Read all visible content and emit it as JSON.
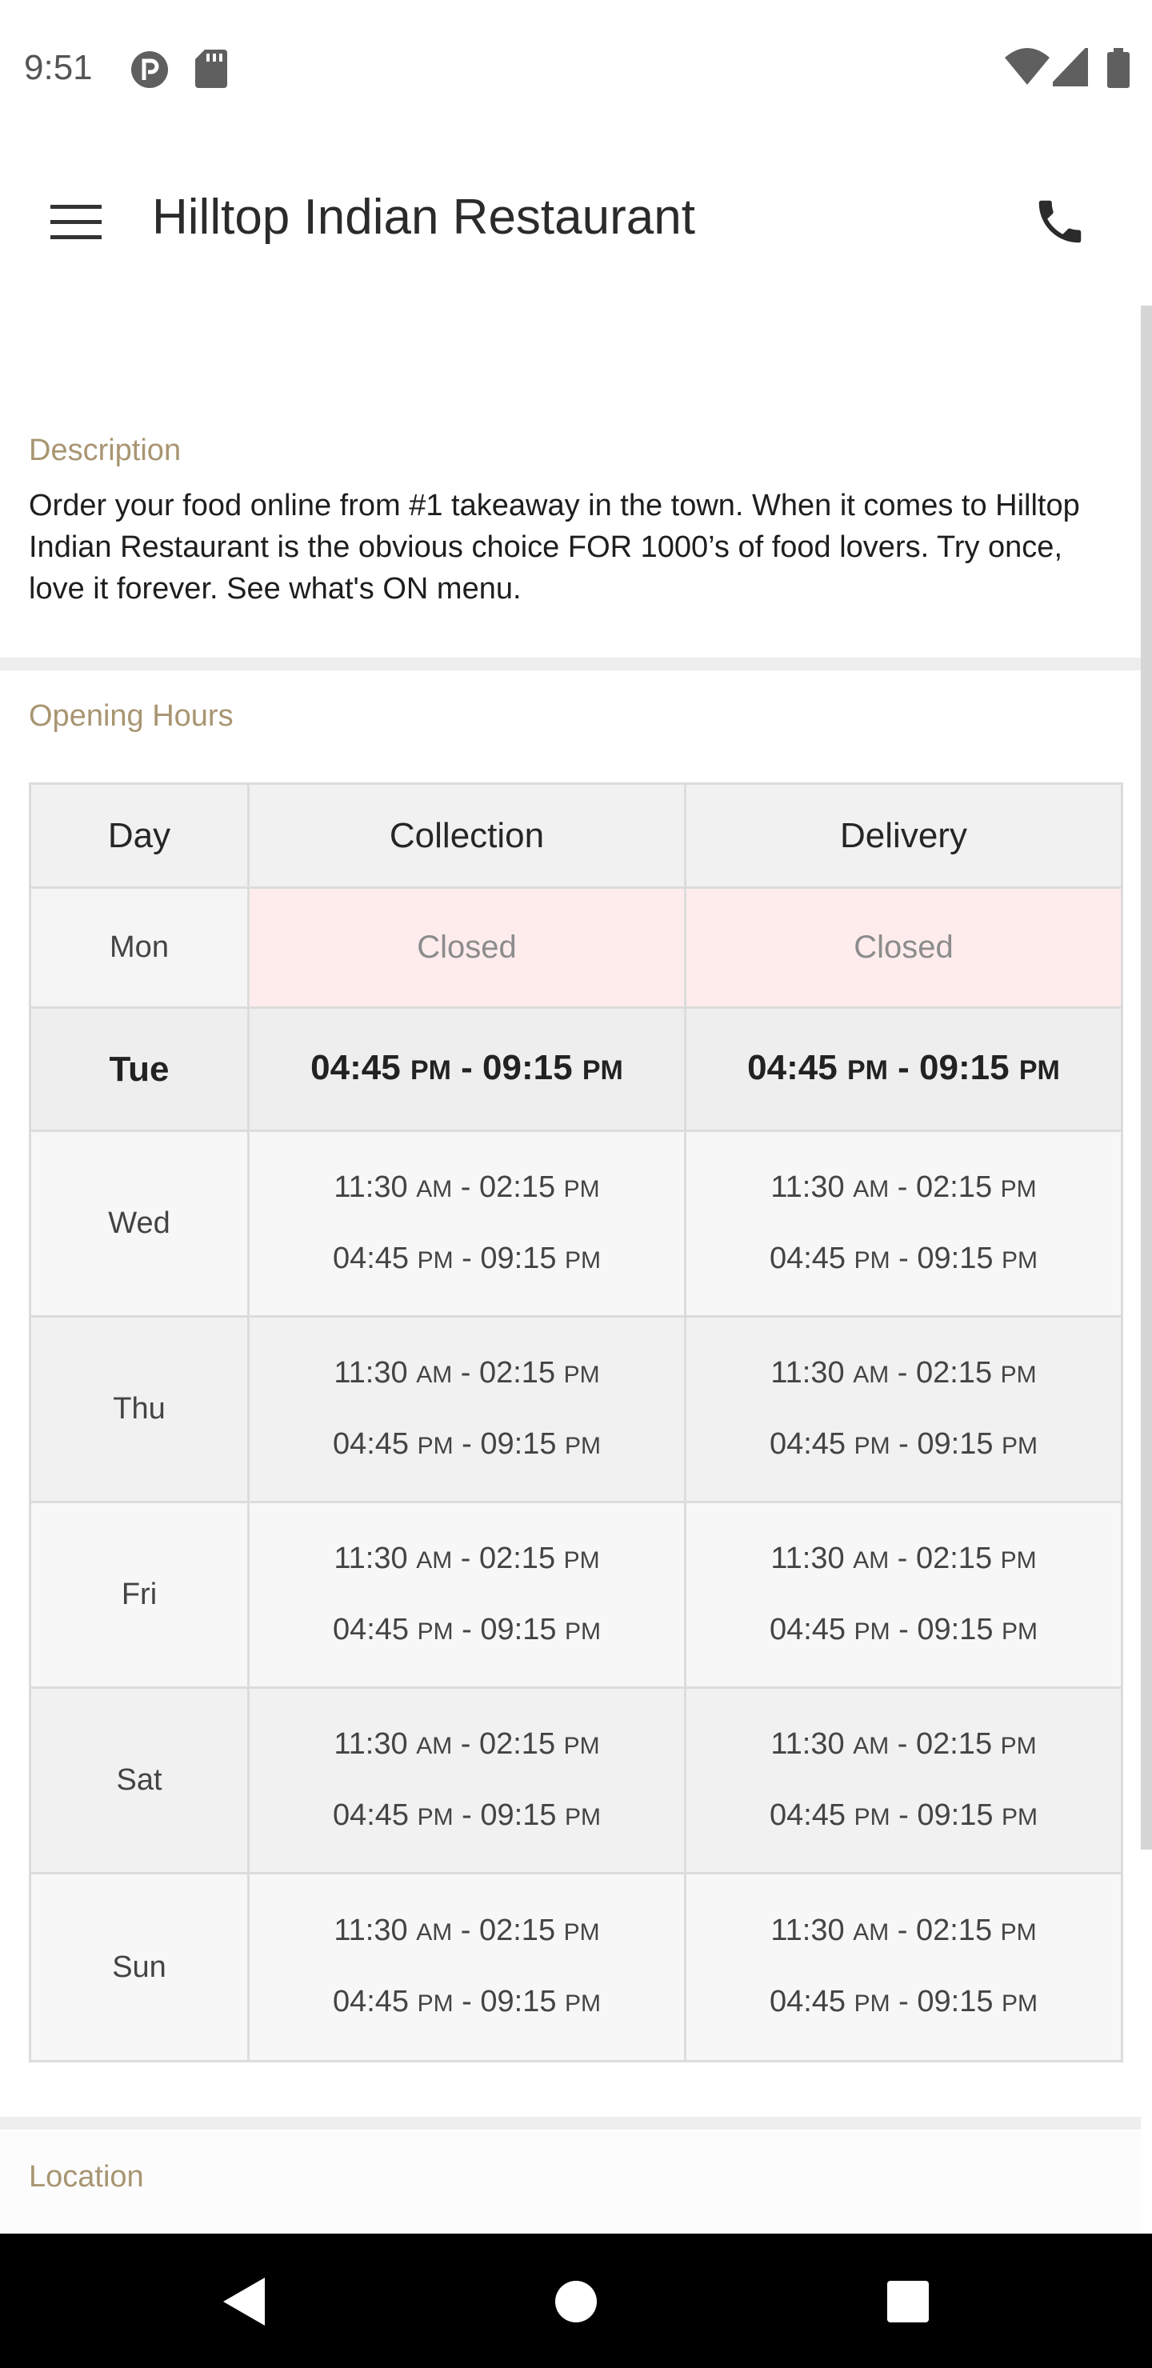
{
  "status_bar": {
    "time": "9:51",
    "left_icons": [
      "podcast-icon",
      "sd-card-icon"
    ],
    "right_icons": [
      "wifi-icon",
      "signal-icon",
      "battery-icon"
    ]
  },
  "app_bar": {
    "title": "Hilltop Indian Restaurant",
    "menu_icon": "hamburger-menu-icon",
    "call_icon": "phone-icon"
  },
  "description": {
    "label": "Description",
    "text": "Order your food online from #1 takeaway in the town. When it comes to Hilltop Indian Restaurant is the obvious choice FOR 1000’s of food lovers. Try once, love it forever. See what's ON menu."
  },
  "opening_hours": {
    "label": "Opening Hours",
    "headers": {
      "day": "Day",
      "collection": "Collection",
      "delivery": "Delivery"
    },
    "mon": {
      "day": "Mon",
      "collection": "Closed",
      "delivery": "Closed"
    },
    "tue": {
      "day": "Tue",
      "collection": {
        "start": "04:45",
        "start_ampm": "PM",
        "sep": " - ",
        "end": "09:15",
        "end_ampm": "PM"
      },
      "delivery": {
        "start": "04:45",
        "start_ampm": "PM",
        "sep": " - ",
        "end": "09:15",
        "end_ampm": "PM"
      }
    },
    "days": [
      {
        "day": "Wed",
        "collection": [
          {
            "start": "11:30",
            "start_ampm": "AM",
            "sep": " - ",
            "end": "02:15",
            "end_ampm": "PM"
          },
          {
            "start": "04:45",
            "start_ampm": "PM",
            "sep": " - ",
            "end": "09:15",
            "end_ampm": "PM"
          }
        ],
        "delivery": [
          {
            "start": "11:30",
            "start_ampm": "AM",
            "sep": " - ",
            "end": "02:15",
            "end_ampm": "PM"
          },
          {
            "start": "04:45",
            "start_ampm": "PM",
            "sep": " - ",
            "end": "09:15",
            "end_ampm": "PM"
          }
        ]
      },
      {
        "day": "Thu",
        "collection": [
          {
            "start": "11:30",
            "start_ampm": "AM",
            "sep": " - ",
            "end": "02:15",
            "end_ampm": "PM"
          },
          {
            "start": "04:45",
            "start_ampm": "PM",
            "sep": " - ",
            "end": "09:15",
            "end_ampm": "PM"
          }
        ],
        "delivery": [
          {
            "start": "11:30",
            "start_ampm": "AM",
            "sep": " - ",
            "end": "02:15",
            "end_ampm": "PM"
          },
          {
            "start": "04:45",
            "start_ampm": "PM",
            "sep": " - ",
            "end": "09:15",
            "end_ampm": "PM"
          }
        ]
      },
      {
        "day": "Fri",
        "collection": [
          {
            "start": "11:30",
            "start_ampm": "AM",
            "sep": " - ",
            "end": "02:15",
            "end_ampm": "PM"
          },
          {
            "start": "04:45",
            "start_ampm": "PM",
            "sep": " - ",
            "end": "09:15",
            "end_ampm": "PM"
          }
        ],
        "delivery": [
          {
            "start": "11:30",
            "start_ampm": "AM",
            "sep": " - ",
            "end": "02:15",
            "end_ampm": "PM"
          },
          {
            "start": "04:45",
            "start_ampm": "PM",
            "sep": " - ",
            "end": "09:15",
            "end_ampm": "PM"
          }
        ]
      },
      {
        "day": "Sat",
        "collection": [
          {
            "start": "11:30",
            "start_ampm": "AM",
            "sep": " - ",
            "end": "02:15",
            "end_ampm": "PM"
          },
          {
            "start": "04:45",
            "start_ampm": "PM",
            "sep": " - ",
            "end": "09:15",
            "end_ampm": "PM"
          }
        ],
        "delivery": [
          {
            "start": "11:30",
            "start_ampm": "AM",
            "sep": " - ",
            "end": "02:15",
            "end_ampm": "PM"
          },
          {
            "start": "04:45",
            "start_ampm": "PM",
            "sep": " - ",
            "end": "09:15",
            "end_ampm": "PM"
          }
        ]
      },
      {
        "day": "Sun",
        "collection": [
          {
            "start": "11:30",
            "start_ampm": "AM",
            "sep": " - ",
            "end": "02:15",
            "end_ampm": "PM"
          },
          {
            "start": "04:45",
            "start_ampm": "PM",
            "sep": " - ",
            "end": "09:15",
            "end_ampm": "PM"
          }
        ],
        "delivery": [
          {
            "start": "11:30",
            "start_ampm": "AM",
            "sep": " - ",
            "end": "02:15",
            "end_ampm": "PM"
          },
          {
            "start": "04:45",
            "start_ampm": "PM",
            "sep": " - ",
            "end": "09:15",
            "end_ampm": "PM"
          }
        ]
      }
    ]
  },
  "location": {
    "label": "Location"
  },
  "nav_bar": {
    "icons": [
      "back-icon",
      "home-icon",
      "recents-icon"
    ]
  },
  "colors": {
    "accent_label": "#a89572",
    "closed_bg": "#fdeceb",
    "table_border": "#dcdcdc"
  }
}
